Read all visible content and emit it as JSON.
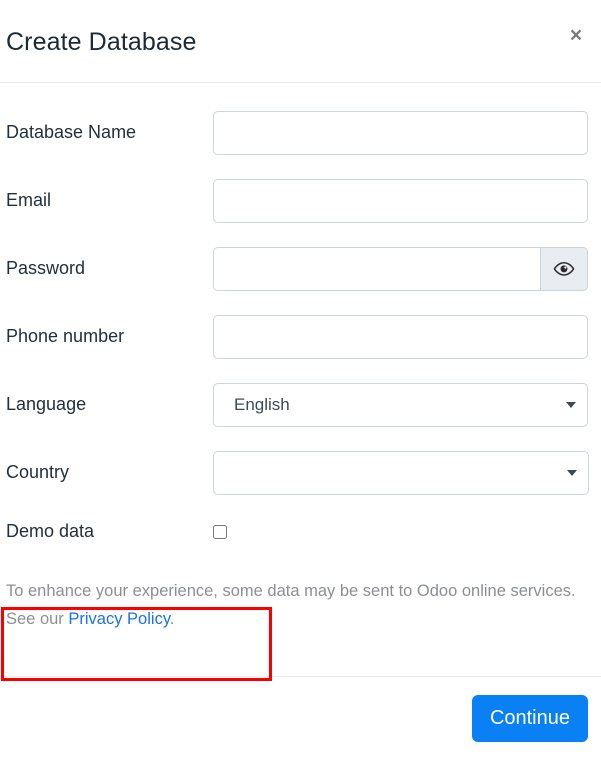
{
  "dialog": {
    "title": "Create Database",
    "close_label": "×",
    "close_icon": "close-icon"
  },
  "form": {
    "fields": [
      {
        "label": "Database Name",
        "value": "",
        "placeholder": "",
        "type": "text",
        "name": "database-name"
      },
      {
        "label": "Email",
        "value": "",
        "placeholder": "",
        "type": "text",
        "name": "email"
      },
      {
        "label": "Password",
        "value": "",
        "placeholder": "",
        "type": "password",
        "name": "password"
      },
      {
        "label": "Phone number",
        "value": "",
        "placeholder": "",
        "type": "text",
        "name": "phone-number"
      },
      {
        "label": "Language",
        "value": "English",
        "type": "select",
        "name": "language"
      },
      {
        "label": "Country",
        "value": "",
        "type": "select",
        "name": "country"
      },
      {
        "label": "Demo data",
        "value": "",
        "type": "checkbox",
        "name": "demo-data",
        "checked": false
      }
    ],
    "reveal_password_icon": "eye-icon",
    "select_arrow_icon": "chevron-down-icon"
  },
  "privacy": {
    "text_before_link": "To enhance your experience, some data may be sent to Odoo online services. See our ",
    "link_text": "Privacy Policy",
    "text_after_link": "."
  },
  "footer": {
    "continue_label": "Continue"
  },
  "annotation": {
    "color": "#fc0000",
    "target": "demo-data"
  },
  "colors": {
    "accent_blue": "#0a80f5",
    "link_blue": "#1a73e8",
    "annotation_red": "#fc0000",
    "label_text": "#22303c",
    "muted_text": "#8b8f93",
    "input_border": "#ccd4dc"
  }
}
